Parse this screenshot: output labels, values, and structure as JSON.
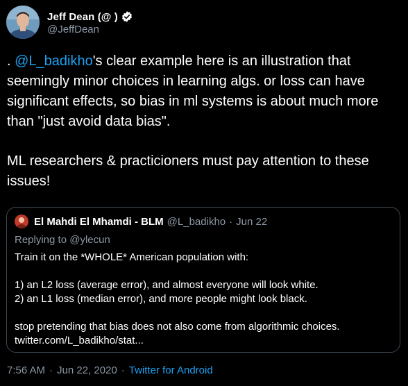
{
  "author": {
    "display_name": "Jeff Dean (@     )",
    "handle": "@JeffDean",
    "verified_icon": "verified-check-icon"
  },
  "tweet": {
    "lead": ". ",
    "mention": "@L_badikho",
    "paragraph1_rest": "'s clear example here is an illustration that seemingly minor choices in learning algs. or loss can have significant effects, so bias in ml systems is about much more than \"just avoid data bias\".",
    "paragraph2": "ML researchers & practicioners must pay attention to these issues!"
  },
  "quote": {
    "name": "El Mahdi El Mhamdi - BLM",
    "handle": "@L_badikho",
    "dot": "·",
    "date": "Jun 22",
    "replying_to": "Replying to @ylecun",
    "line1": "Train it on the *WHOLE* American population with:",
    "line2": "1) an L2 loss (average error), and almost everyone will look white.",
    "line3": "2) an L1 loss (median error), and more people might look black.",
    "line4": "stop pretending that bias does not also come from algorithmic choices.",
    "line5": "twitter.com/L_badikho/stat..."
  },
  "footer": {
    "time": "7:56 AM",
    "sep1": "·",
    "date": "Jun 22, 2020",
    "sep2": "·",
    "source": "Twitter for Android"
  },
  "colors": {
    "background": "#000000",
    "link": "#1da1f2",
    "secondary_text": "#8b98a5",
    "card_border": "#3d4852"
  }
}
